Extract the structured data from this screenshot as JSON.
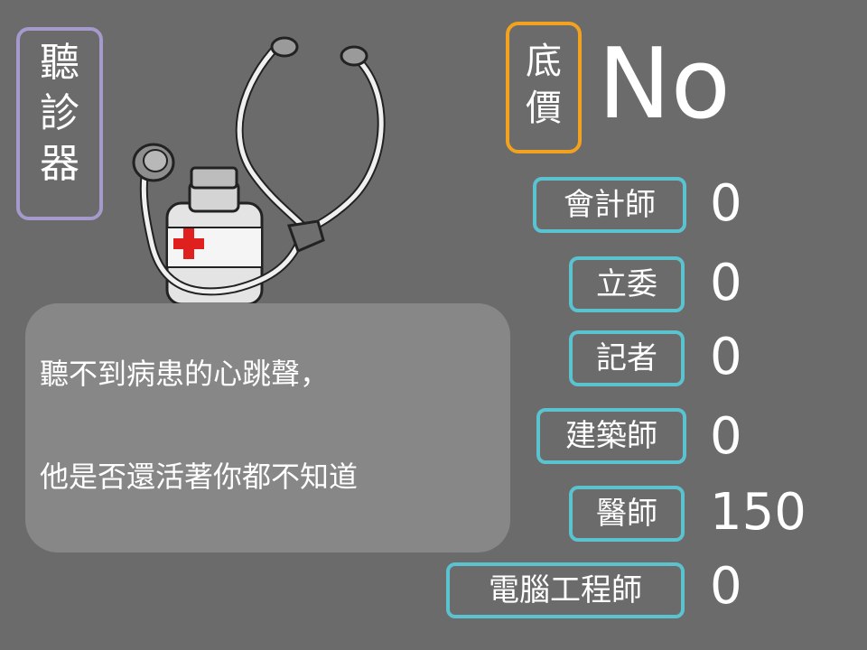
{
  "title": {
    "chars": [
      "聽",
      "診",
      "器"
    ]
  },
  "base_price": {
    "label_chars": [
      "底",
      "價"
    ],
    "value": "No"
  },
  "description": {
    "line1": "聽不到病患的心跳聲，",
    "line2": "他是否還活著你都不知道"
  },
  "jobs": [
    {
      "label": "會計師",
      "value": "0"
    },
    {
      "label": "立委",
      "value": "0"
    },
    {
      "label": "記者",
      "value": "0"
    },
    {
      "label": "建築師",
      "value": "0"
    },
    {
      "label": "醫師",
      "value": "150"
    },
    {
      "label": "電腦工程師",
      "value": "0"
    }
  ],
  "colors": {
    "background": "#6b6b6b",
    "title_border": "#a59acb",
    "price_border": "#f2a21e",
    "job_border": "#5bc2d0",
    "desc_box": "#878787"
  },
  "icons": [
    "stethoscope-icon",
    "medicine-bottle-icon"
  ]
}
